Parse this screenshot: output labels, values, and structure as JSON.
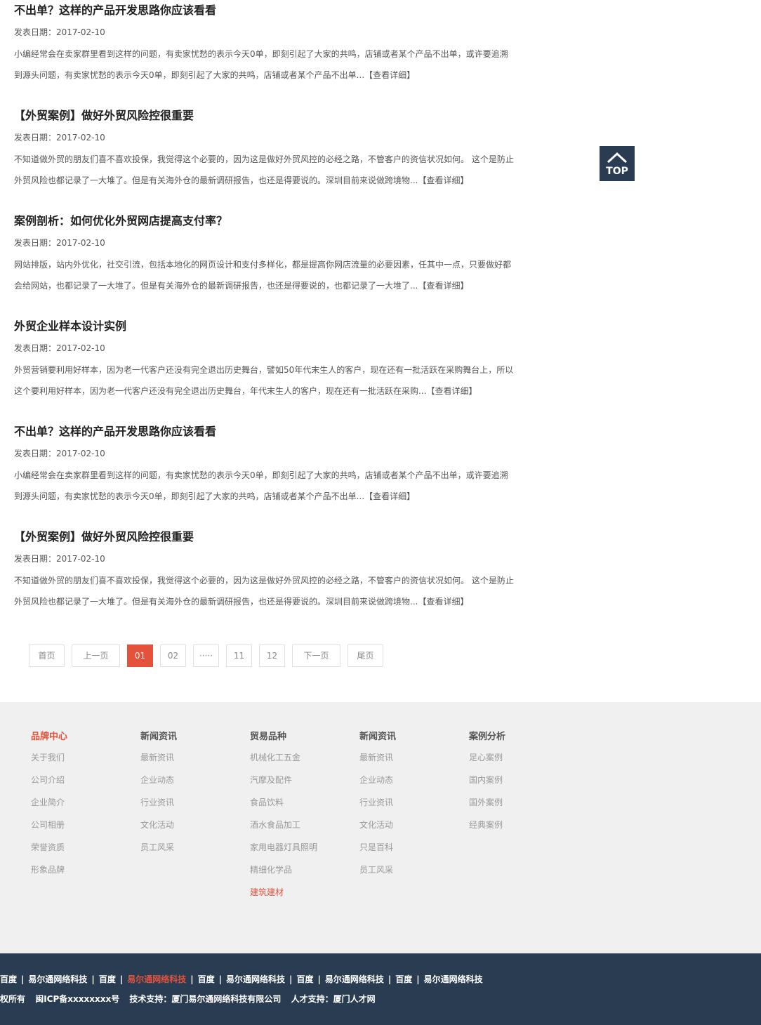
{
  "articles": [
    {
      "title": "不出单？这样的产品开发思路你应该看看",
      "date": "发表日期：2017-02-10",
      "summary": "小编经常会在卖家群里看到这样的问题，有卖家忧愁的表示今天0单，即刻引起了大家的共鸣，店铺或者某个产品不出单，或许要追溯到源头问题，有卖家忧愁的表示今天0单，即刻引起了大家的共鸣，店铺或者某个产品不出单...",
      "more": "【查看详细】"
    },
    {
      "title": "【外贸案例】做好外贸风险控很重要",
      "date": "发表日期：2017-02-10",
      "summary": "不知道做外贸的朋友们喜不喜欢投保，我觉得这个必要的，因为这是做好外贸风控的必经之路，不管客户的资信状况如何。 这个是防止外贸风险也都记录了一大堆了。但是有关海外仓的最新调研报告，也还是得要说的。深圳目前来说做跨境物...",
      "more": "【查看详细】"
    },
    {
      "title": "案例剖析：如何优化外贸网店提高支付率？",
      "date": "发表日期：2017-02-10",
      "summary": "网站排版，站内外优化，社交引流，包括本地化的网页设计和支付多样化，都是提高你网店流量的必要因素，任其中一点，只要做好都会给网站，也都记录了一大堆了。但是有关海外仓的最新调研报告，也还是得要说的，也都记录了一大堆了...",
      "more": "【查看详细】"
    },
    {
      "title": "外贸企业样本设计实例",
      "date": "发表日期：2017-02-10",
      "summary": "外贸营销要利用好样本，因为老一代客户还没有完全退出历史舞台，譬如50年代末生人的客户，现在还有一批活跃在采购舞台上，所以这个要利用好样本，因为老一代客户还没有完全退出历史舞台，年代末生人的客户，现在还有一批活跃在采购...",
      "more": "【查看详细】"
    },
    {
      "title": "不出单？这样的产品开发思路你应该看看",
      "date": "发表日期：2017-02-10",
      "summary": "小编经常会在卖家群里看到这样的问题，有卖家忧愁的表示今天0单，即刻引起了大家的共鸣，店铺或者某个产品不出单，或许要追溯到源头问题，有卖家忧愁的表示今天0单，即刻引起了大家的共鸣，店铺或者某个产品不出单...",
      "more": "【查看详细】"
    },
    {
      "title": "【外贸案例】做好外贸风险控很重要",
      "date": "发表日期：2017-02-10",
      "summary": "不知道做外贸的朋友们喜不喜欢投保，我觉得这个必要的，因为这是做好外贸风控的必经之路，不管客户的资信状况如何。 这个是防止外贸风险也都记录了一大堆了。但是有关海外仓的最新调研报告，也还是得要说的。深圳目前来说做跨境物...",
      "more": "【查看详细】"
    }
  ],
  "top_button": {
    "label": "TOP"
  },
  "pagination": {
    "first": "首页",
    "prev": "上一页",
    "pages": [
      "01",
      "02",
      "·····",
      "11",
      "12"
    ],
    "next": "下一页",
    "last": "尾页",
    "active_page": "01"
  },
  "footer_nav": [
    {
      "heading": "品牌中心",
      "heading_highlight": true,
      "links": [
        "关于我们",
        "公司介绍",
        "企业简介",
        "公司相册",
        "荣誉资质",
        "形象品牌"
      ]
    },
    {
      "heading": "新闻资讯",
      "links": [
        "最新资讯",
        "企业动态",
        "行业资讯",
        "文化活动",
        "员工风采"
      ]
    },
    {
      "heading": "贸易品种",
      "links": [
        "机械化工五金",
        "汽摩及配件",
        "食品饮料",
        "酒水食品加工",
        "家用电器灯具照明",
        "精细化学品",
        "建筑建材"
      ],
      "highlight_link": "建筑建材"
    },
    {
      "heading": "新闻资讯",
      "links": [
        "最新资讯",
        "企业动态",
        "行业资讯",
        "文化活动",
        "只是百科",
        "员工风采"
      ]
    },
    {
      "heading": "案例分析",
      "links": [
        "足心案例",
        "国内案例",
        "国外案例",
        "经典案例"
      ]
    }
  ],
  "footer_links": [
    "百度",
    "易尔通网络科技",
    "百度",
    "易尔通网络科技",
    "百度",
    "易尔通网络科技",
    "百度",
    "易尔通网络科技",
    "百度",
    "易尔通网络科技"
  ],
  "footer_link_highlight_index": 3,
  "footer_link_separator": "|",
  "copyright": {
    "rights": "权所有",
    "icp": "闽ICP备xxxxxxxx号",
    "tech": "技术支持：厦门易尔通网络科技有限公司",
    "talent": "人才支持：厦门人才网"
  },
  "colors": {
    "accent": "#e5523b",
    "dark_footer": "#2a3c52",
    "light_footer": "#f0f0f0"
  }
}
